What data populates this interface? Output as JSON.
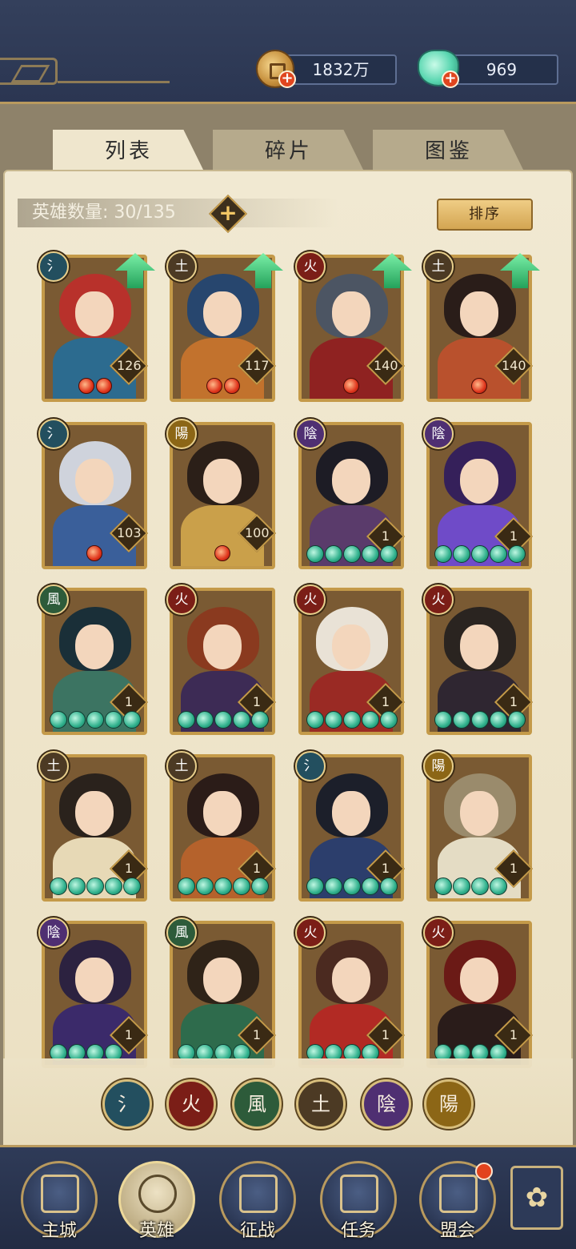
{
  "resources": {
    "copper": {
      "value": "1832万",
      "icon": "coin-icon"
    },
    "jade": {
      "value": "969",
      "icon": "jade-icon"
    }
  },
  "tabs": [
    {
      "label": "列表",
      "active": true
    },
    {
      "label": "碎片",
      "active": false
    },
    {
      "label": "图鉴",
      "active": false
    }
  ],
  "hero_count": "英雄数量: 30/135",
  "sort_label": "排序",
  "elements": {
    "water": {
      "glyph": "氵",
      "color": "#234f5f"
    },
    "fire": {
      "glyph": "火",
      "color": "#7b1e17"
    },
    "wind": {
      "glyph": "風",
      "color": "#2d5b3a"
    },
    "earth": {
      "glyph": "土",
      "color": "#4c3a24"
    },
    "yin": {
      "glyph": "陰",
      "color": "#4f2f72"
    },
    "yang": {
      "glyph": "陽",
      "color": "#8c6616"
    }
  },
  "heroes": [
    {
      "element": "water",
      "level": "126",
      "upgrade": true,
      "red_stars": 2,
      "jade_stars": 0,
      "hair": "#b8312b",
      "outfit": "#2c6b8f"
    },
    {
      "element": "earth",
      "level": "117",
      "upgrade": true,
      "red_stars": 2,
      "jade_stars": 0,
      "hair": "#27466e",
      "outfit": "#c2722d"
    },
    {
      "element": "fire",
      "level": "140",
      "upgrade": true,
      "red_stars": 1,
      "jade_stars": 0,
      "hair": "#4c5563",
      "outfit": "#8f2221"
    },
    {
      "element": "earth",
      "level": "140",
      "upgrade": true,
      "red_stars": 1,
      "jade_stars": 0,
      "hair": "#2a1d19",
      "outfit": "#b9512d"
    },
    {
      "element": "water",
      "level": "103",
      "upgrade": false,
      "red_stars": 1,
      "jade_stars": 0,
      "hair": "#cfd3dc",
      "outfit": "#3a5f9a"
    },
    {
      "element": "yang",
      "level": "100",
      "upgrade": false,
      "red_stars": 1,
      "jade_stars": 0,
      "hair": "#2b1f18",
      "outfit": "#caa04a"
    },
    {
      "element": "yin",
      "level": "1",
      "upgrade": false,
      "red_stars": 0,
      "jade_stars": 5,
      "hair": "#1d1c25",
      "outfit": "#5a3b6b"
    },
    {
      "element": "yin",
      "level": "1",
      "upgrade": false,
      "red_stars": 0,
      "jade_stars": 5,
      "hair": "#35205a",
      "outfit": "#6f4bc8"
    },
    {
      "element": "wind",
      "level": "1",
      "upgrade": false,
      "red_stars": 0,
      "jade_stars": 5,
      "hair": "#1a2f38",
      "outfit": "#3c7462"
    },
    {
      "element": "fire",
      "level": "1",
      "upgrade": false,
      "red_stars": 0,
      "jade_stars": 5,
      "hair": "#8a3a1f",
      "outfit": "#3d2b55"
    },
    {
      "element": "fire",
      "level": "1",
      "upgrade": false,
      "red_stars": 0,
      "jade_stars": 5,
      "hair": "#e9e2d6",
      "outfit": "#9a2a24"
    },
    {
      "element": "fire",
      "level": "1",
      "upgrade": false,
      "red_stars": 0,
      "jade_stars": 5,
      "hair": "#2a2420",
      "outfit": "#2f2631"
    },
    {
      "element": "earth",
      "level": "1",
      "upgrade": false,
      "red_stars": 0,
      "jade_stars": 5,
      "hair": "#2a221c",
      "outfit": "#e7d9b6"
    },
    {
      "element": "earth",
      "level": "1",
      "upgrade": false,
      "red_stars": 0,
      "jade_stars": 5,
      "hair": "#2b1c18",
      "outfit": "#b5622c"
    },
    {
      "element": "water",
      "level": "1",
      "upgrade": false,
      "red_stars": 0,
      "jade_stars": 5,
      "hair": "#1c1f2a",
      "outfit": "#2c3e6c"
    },
    {
      "element": "yang",
      "level": "1",
      "upgrade": false,
      "red_stars": 0,
      "jade_stars": 4,
      "hair": "#9a8b6c",
      "outfit": "#e4dcc4"
    },
    {
      "element": "yin",
      "level": "1",
      "upgrade": false,
      "red_stars": 0,
      "jade_stars": 4,
      "hair": "#2c2240",
      "outfit": "#3b2a6a"
    },
    {
      "element": "wind",
      "level": "1",
      "upgrade": false,
      "red_stars": 0,
      "jade_stars": 4,
      "hair": "#2f2318",
      "outfit": "#2e6b4c"
    },
    {
      "element": "fire",
      "level": "1",
      "upgrade": false,
      "red_stars": 0,
      "jade_stars": 4,
      "hair": "#4b2a20",
      "outfit": "#b22a24"
    },
    {
      "element": "fire",
      "level": "1",
      "upgrade": false,
      "red_stars": 0,
      "jade_stars": 4,
      "hair": "#6b1a16",
      "outfit": "#2a1c1a"
    }
  ],
  "filters": [
    "water",
    "fire",
    "wind",
    "earth",
    "yin",
    "yang"
  ],
  "nav": [
    {
      "label": "主城",
      "icon": "city-gate-icon",
      "active": false
    },
    {
      "label": "英雄",
      "icon": "hero-portrait-icon",
      "active": true
    },
    {
      "label": "征战",
      "icon": "battle-icon",
      "active": false
    },
    {
      "label": "任务",
      "icon": "scroll-icon",
      "active": false
    },
    {
      "label": "盟会",
      "icon": "alliance-hall-icon",
      "active": false
    }
  ],
  "more_icon": "menu-flower-icon"
}
